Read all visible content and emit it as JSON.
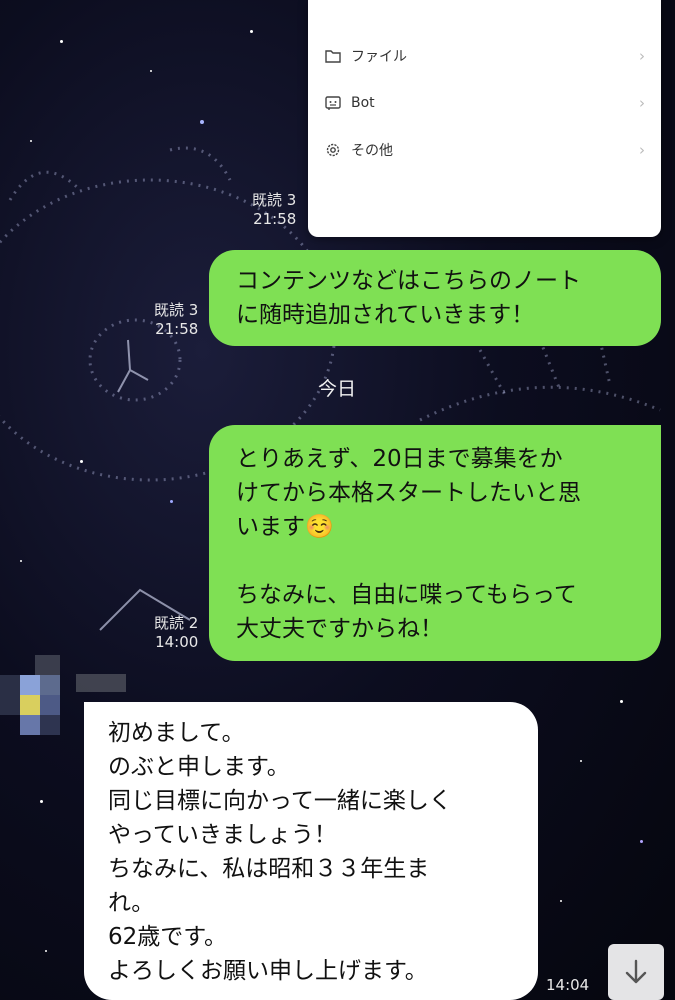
{
  "menu": {
    "items": [
      {
        "label": "ファイル",
        "icon": "folder-icon"
      },
      {
        "label": "Bot",
        "icon": "bot-icon"
      },
      {
        "label": "その他",
        "icon": "gear-icon"
      }
    ]
  },
  "messages": [
    {
      "read": "既読 3",
      "time": "21:58"
    },
    {
      "read": "既読 3",
      "time": "21:58",
      "lines": [
        "コンテンツなどはこちらのノート",
        "に随時追加されていきます！"
      ]
    },
    {
      "read": "既読 2",
      "time": "14:00",
      "lines": [
        "とりあえず、20日まで募集をか",
        "けてから本格スタートしたいと思",
        "います☺️",
        "",
        "ちなみに、自由に喋ってもらって",
        "大丈夫ですからね！"
      ]
    },
    {
      "time": "14:04",
      "lines": [
        "初めまして。",
        "のぶと申します。",
        "同じ目標に向かって一緒に楽しく",
        "やっていきましょう！",
        "ちなみに、私は昭和３３年生ま",
        "れ。",
        "62歳です。",
        "よろしくお願い申し上げます。"
      ]
    }
  ],
  "date_separator": "今日",
  "scroll_button_icon": "arrow-down-icon",
  "colors": {
    "my_bubble": "#7fe054",
    "their_bubble": "#ffffff"
  }
}
